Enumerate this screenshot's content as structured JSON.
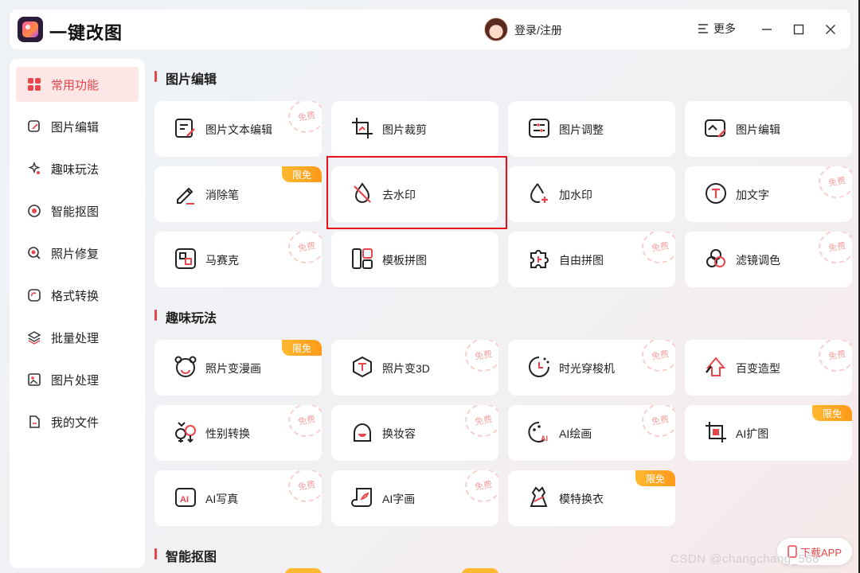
{
  "titlebar": {
    "app_title": "一键改图",
    "login_label": "登录/注册",
    "more_label": "更多"
  },
  "sidebar": {
    "items": [
      {
        "label": "常用功能",
        "icon": "grid-icon",
        "active": true
      },
      {
        "label": "图片编辑",
        "icon": "edit-icon"
      },
      {
        "label": "趣味玩法",
        "icon": "sparkle-icon"
      },
      {
        "label": "智能抠图",
        "icon": "target-icon"
      },
      {
        "label": "照片修复",
        "icon": "repair-icon"
      },
      {
        "label": "格式转换",
        "icon": "convert-icon"
      },
      {
        "label": "批量处理",
        "icon": "layers-icon"
      },
      {
        "label": "图片处理",
        "icon": "image-icon"
      },
      {
        "label": "我的文件",
        "icon": "file-icon"
      }
    ]
  },
  "badges": {
    "free": "免费",
    "limited": "限免"
  },
  "sections": [
    {
      "title": "图片编辑",
      "cards": [
        {
          "label": "图片文本编辑",
          "icon": "text-edit-icon",
          "badge": "free"
        },
        {
          "label": "图片裁剪",
          "icon": "crop-icon",
          "badge": ""
        },
        {
          "label": "图片调整",
          "icon": "adjust-icon",
          "badge": ""
        },
        {
          "label": "图片编辑",
          "icon": "image-edit-icon",
          "badge": ""
        },
        {
          "label": "消除笔",
          "icon": "eraser-pen-icon",
          "badge": "limited"
        },
        {
          "label": "去水印",
          "icon": "remove-watermark-icon",
          "badge": ""
        },
        {
          "label": "加水印",
          "icon": "add-watermark-icon",
          "badge": ""
        },
        {
          "label": "加文字",
          "icon": "add-text-icon",
          "badge": "free"
        },
        {
          "label": "马赛克",
          "icon": "mosaic-icon",
          "badge": "free"
        },
        {
          "label": "模板拼图",
          "icon": "template-collage-icon",
          "badge": ""
        },
        {
          "label": "自由拼图",
          "icon": "free-collage-icon",
          "badge": "free"
        },
        {
          "label": "滤镜调色",
          "icon": "filter-icon",
          "badge": "free"
        }
      ]
    },
    {
      "title": "趣味玩法",
      "cards": [
        {
          "label": "照片变漫画",
          "icon": "cartoon-icon",
          "badge": "limited"
        },
        {
          "label": "照片变3D",
          "icon": "cube-3d-icon",
          "badge": "free"
        },
        {
          "label": "时光穿梭机",
          "icon": "time-machine-icon",
          "badge": "free"
        },
        {
          "label": "百变造型",
          "icon": "style-icon",
          "badge": "free"
        },
        {
          "label": "性别转换",
          "icon": "gender-swap-icon",
          "badge": "free"
        },
        {
          "label": "换妆容",
          "icon": "makeup-icon",
          "badge": "free"
        },
        {
          "label": "AI绘画",
          "icon": "ai-painting-icon",
          "badge": "free"
        },
        {
          "label": "AI扩图",
          "icon": "ai-expand-icon",
          "badge": "limited"
        },
        {
          "label": "AI写真",
          "icon": "ai-portrait-icon",
          "badge": "free"
        },
        {
          "label": "AI字画",
          "icon": "ai-calligraphy-icon",
          "badge": "free"
        },
        {
          "label": "模特换衣",
          "icon": "outfit-swap-icon",
          "badge": "limited"
        }
      ]
    },
    {
      "title": "智能抠图",
      "cards": []
    }
  ],
  "download_app_label": "下载APP",
  "watermark": "CSDN @changchang_568",
  "colors": {
    "accent": "#e8464a",
    "limited_badge": "#ffab26",
    "highlight_box": "#e6101c"
  }
}
